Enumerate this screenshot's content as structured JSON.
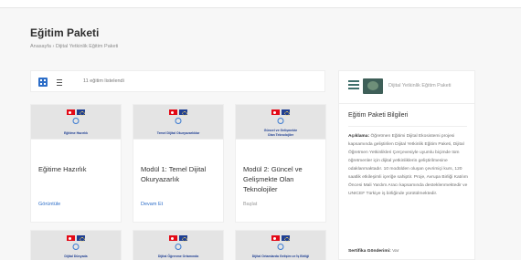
{
  "page": {
    "title": "Eğitim Paketi",
    "breadcrumb": {
      "home": "Anasayfa",
      "separator": "›",
      "current": "Dijital Yetkinlik Eğitim Paketi"
    }
  },
  "toolbar": {
    "grid_view_icon": "grid-icon",
    "list_view_icon": "list-icon",
    "count_text": "11 eğitim listelendi"
  },
  "trainings": [
    {
      "thumb_text": "Eğitime Hazırlık",
      "title": "Eğitime Hazırlık",
      "action": "Görüntüle"
    },
    {
      "thumb_text": "Temel Dijital Okuryazarlıklar",
      "title": "Modül 1: Temel Dijital Okuryazarlık",
      "action": "Devam Et"
    },
    {
      "thumb_text": "Güncel ve Gelişmekte Olan Teknolojiler",
      "title": "Modül 2: Güncel ve Gelişmekte Olan Teknolojiler",
      "action": "Başlat"
    },
    {
      "thumb_text": "Dijital Dünyada",
      "title": "",
      "action": ""
    },
    {
      "thumb_text": "Dijital Öğrenme Ortamında",
      "title": "",
      "action": ""
    },
    {
      "thumb_text": "Dijital Ortamlarda Gelişim ve İş Birliği",
      "title": "",
      "action": ""
    }
  ],
  "sidebar": {
    "package_name": "Dijital Yetkinlik Eğitim Paketi",
    "info_title": "Eğitim Paketi Bilgileri",
    "description_label": "Açıklama:",
    "description_text": "Öğretmen Eğitimi Dijital Ekosistemi projesi kapsamında geliştirilen Dijital Yetkinlik Eğitim Paketi, Dijital Öğretmen Yetkinlikleri Çerçevesiyle uyumlu biçimde tüm öğretmenler için dijital yetkinliklerin geliştirilmesine odaklanmaktadır. 10 modülden oluşan çevrimiçi kurs, 120 saatlik etkileşimli içeriğe sahiptir. Proje, Avrupa Birliği Katılım Öncesi Mali Yardım Aracı kapsamında desteklenmektedir ve UNICEF Türkiye iş birliğinde yürütülmektedir.",
    "certificate_label": "Sertifika Gönderimi:",
    "certificate_value": "Var"
  },
  "colors": {
    "accent": "#2d6ec8",
    "background": "#f7f7f7",
    "card": "#ffffff",
    "flag_red": "#e30a17",
    "flag_blue": "#1f3f93"
  }
}
